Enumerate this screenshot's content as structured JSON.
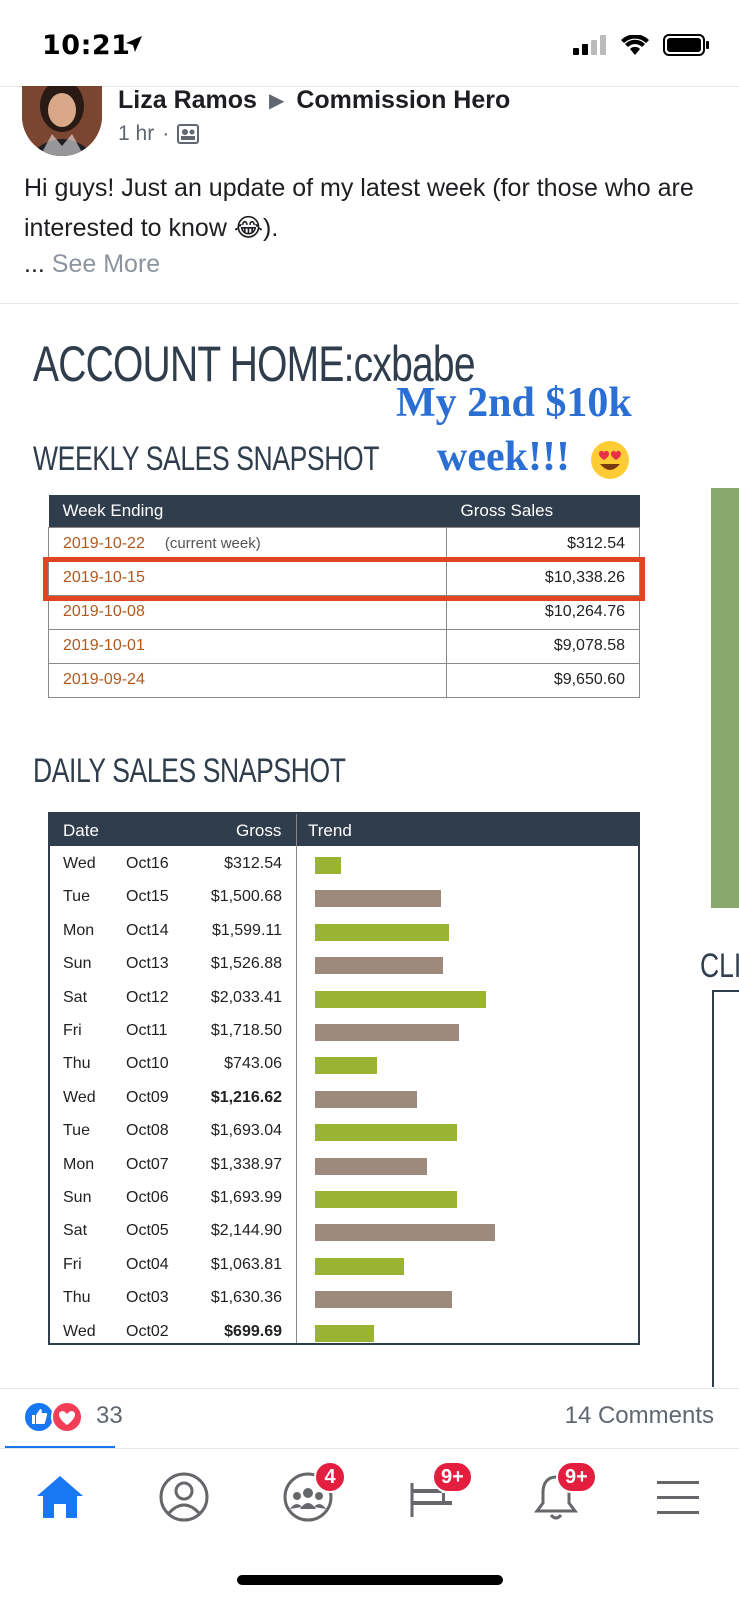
{
  "status_bar": {
    "time": "10:21"
  },
  "post": {
    "author": "Liza Ramos",
    "group": "Commission Hero",
    "time_ago": "1 hr",
    "meta_sep": "·",
    "text": "Hi guys! Just an update of my latest week (for those who are interested to know 😂).",
    "see_more_prefix": "...",
    "see_more": "See More"
  },
  "image": {
    "title_prefix": "ACCOUNT HOME:",
    "title_user": "cxbabe",
    "note_line1": "My 2nd $10k",
    "note_line2": "week!!!",
    "weekly_title": "WEEKLY SALES SNAPSHOT",
    "weekly_headers": [
      "Week Ending",
      "Gross Sales"
    ],
    "weekly_current_note": "(current week)",
    "weekly_rows": [
      {
        "date": "2019-10-22",
        "amount": "$312.54"
      },
      {
        "date": "2019-10-15",
        "amount": "$10,338.26"
      },
      {
        "date": "2019-10-08",
        "amount": "$10,264.76"
      },
      {
        "date": "2019-10-01",
        "amount": "$9,078.58"
      },
      {
        "date": "2019-09-24",
        "amount": "$9,650.60"
      }
    ],
    "daily_title": "DAILY SALES SNAPSHOT",
    "daily_headers": [
      "Date",
      "Gross",
      "Trend"
    ],
    "daily_rows": [
      {
        "day": "Wed",
        "date": "Oct16",
        "gross": "$312.54",
        "value": 312.54,
        "bold": false,
        "color": "#9bb332"
      },
      {
        "day": "Tue",
        "date": "Oct15",
        "gross": "$1,500.68",
        "value": 1500.68,
        "bold": false,
        "color": "#9d8a7c"
      },
      {
        "day": "Mon",
        "date": "Oct14",
        "gross": "$1,599.11",
        "value": 1599.11,
        "bold": false,
        "color": "#9bb332"
      },
      {
        "day": "Sun",
        "date": "Oct13",
        "gross": "$1,526.88",
        "value": 1526.88,
        "bold": false,
        "color": "#9d8a7c"
      },
      {
        "day": "Sat",
        "date": "Oct12",
        "gross": "$2,033.41",
        "value": 2033.41,
        "bold": false,
        "color": "#9bb332"
      },
      {
        "day": "Fri",
        "date": "Oct11",
        "gross": "$1,718.50",
        "value": 1718.5,
        "bold": false,
        "color": "#9d8a7c"
      },
      {
        "day": "Thu",
        "date": "Oct10",
        "gross": "$743.06",
        "value": 743.06,
        "bold": false,
        "color": "#9bb332"
      },
      {
        "day": "Wed",
        "date": "Oct09",
        "gross": "$1,216.62",
        "value": 1216.62,
        "bold": true,
        "color": "#9d8a7c"
      },
      {
        "day": "Tue",
        "date": "Oct08",
        "gross": "$1,693.04",
        "value": 1693.04,
        "bold": false,
        "color": "#9bb332"
      },
      {
        "day": "Mon",
        "date": "Oct07",
        "gross": "$1,338.97",
        "value": 1338.97,
        "bold": false,
        "color": "#9d8a7c"
      },
      {
        "day": "Sun",
        "date": "Oct06",
        "gross": "$1,693.99",
        "value": 1693.99,
        "bold": false,
        "color": "#9bb332"
      },
      {
        "day": "Sat",
        "date": "Oct05",
        "gross": "$2,144.90",
        "value": 2144.9,
        "bold": false,
        "color": "#9d8a7c"
      },
      {
        "day": "Fri",
        "date": "Oct04",
        "gross": "$1,063.81",
        "value": 1063.81,
        "bold": false,
        "color": "#9bb332"
      },
      {
        "day": "Thu",
        "date": "Oct03",
        "gross": "$1,630.36",
        "value": 1630.36,
        "bold": false,
        "color": "#9d8a7c"
      },
      {
        "day": "Wed",
        "date": "Oct02",
        "gross": "$699.69",
        "value": 699.69,
        "bold": true,
        "color": "#9bb332"
      }
    ],
    "side_text": "CLI",
    "highlight_color": "#e04420"
  },
  "reactions": {
    "count": "33",
    "comments": "14 Comments"
  },
  "nav": {
    "groups_badge": "4",
    "watch_badge": "9+",
    "notifications_badge": "9+"
  },
  "colors": {
    "accent": "#1877f2",
    "badge": "#e41e3f",
    "navy": "#2f3d4c"
  }
}
